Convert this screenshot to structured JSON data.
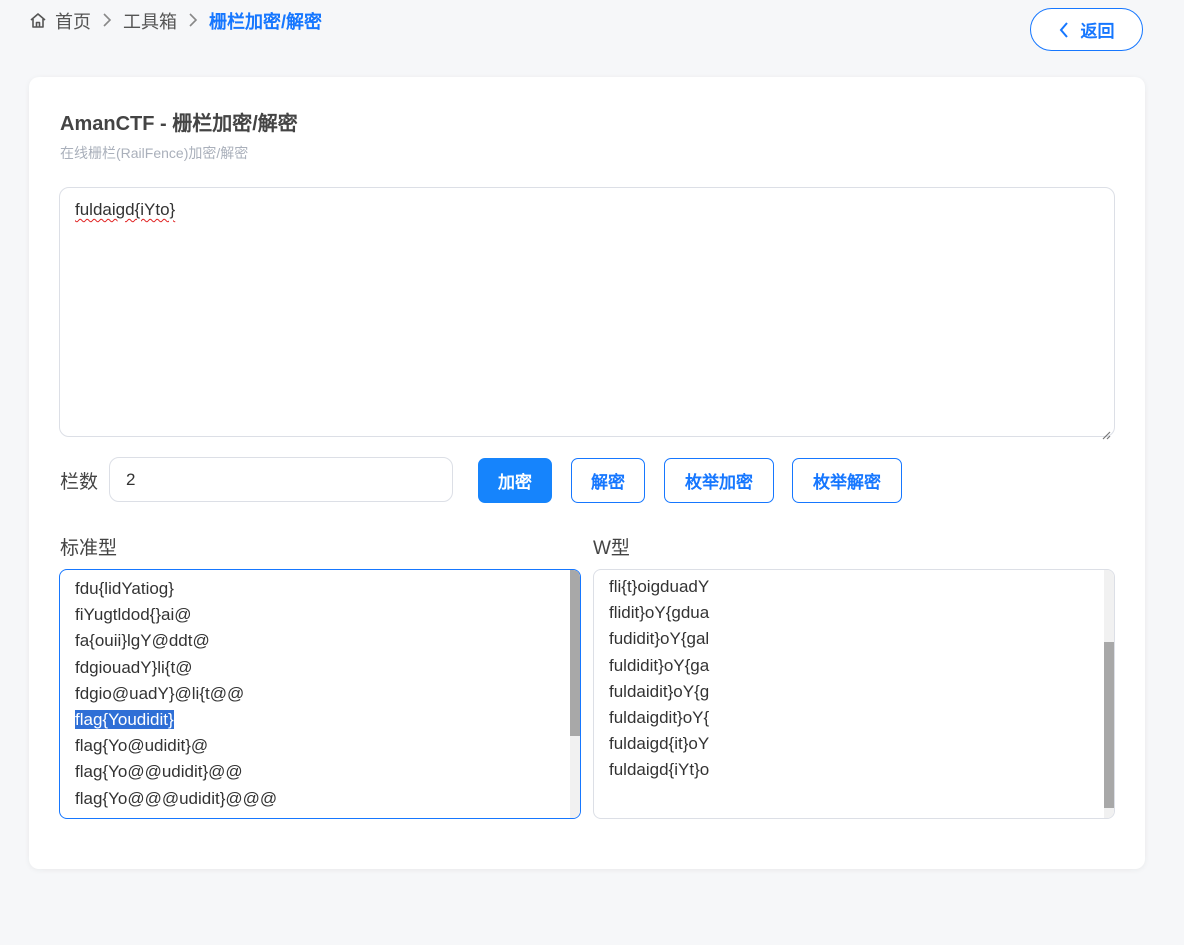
{
  "breadcrumb": {
    "home": "首页",
    "toolbox": "工具箱",
    "current": "栅栏加密/解密"
  },
  "back_button": {
    "label": "返回"
  },
  "card": {
    "title": "AmanCTF - 栅栏加密/解密",
    "subtitle": "在线栅栏(RailFence)加密/解密"
  },
  "input": {
    "value": "fuldaigd{iYto}"
  },
  "rails": {
    "label": "栏数",
    "value": "2"
  },
  "buttons": {
    "encrypt": "加密",
    "decrypt": "解密",
    "enum_encrypt": "枚举加密",
    "enum_decrypt": "枚举解密"
  },
  "standard": {
    "label": "标准型",
    "lines": [
      "fdu{lidYatiog}",
      "fiYugtldod{}ai@",
      "fa{ouii}lgY@ddt@",
      "fdgiouadY}li{t@",
      "fdgio@uadY}@li{t@@",
      "flag{Youdidit}",
      "flag{Yo@udidit}@",
      "flag{Yo@@udidit}@@",
      "flag{Yo@@@udidit}@@@"
    ],
    "selected_line": "flag{Youdidit}"
  },
  "w_type": {
    "label": "W型",
    "lines": [
      "fli{t}oigduadY",
      "flidit}oY{gdua",
      "fudidit}oY{gal",
      "fuldidit}oY{ga",
      "fuldaidit}oY{g",
      "fuldaigdit}oY{",
      "fuldaigd{it}oY",
      "fuldaigd{iYt}o"
    ]
  },
  "icons": {
    "home": "home-icon",
    "breadcrumb_separator": "chevron-right-icon",
    "back": "chevron-left-icon",
    "resize": "resize-grip-icon"
  },
  "colors": {
    "accent": "#1677ff",
    "primary_button": "#1684fc",
    "selection": "#2f6fd6",
    "page_bg": "#f6f7f9"
  }
}
